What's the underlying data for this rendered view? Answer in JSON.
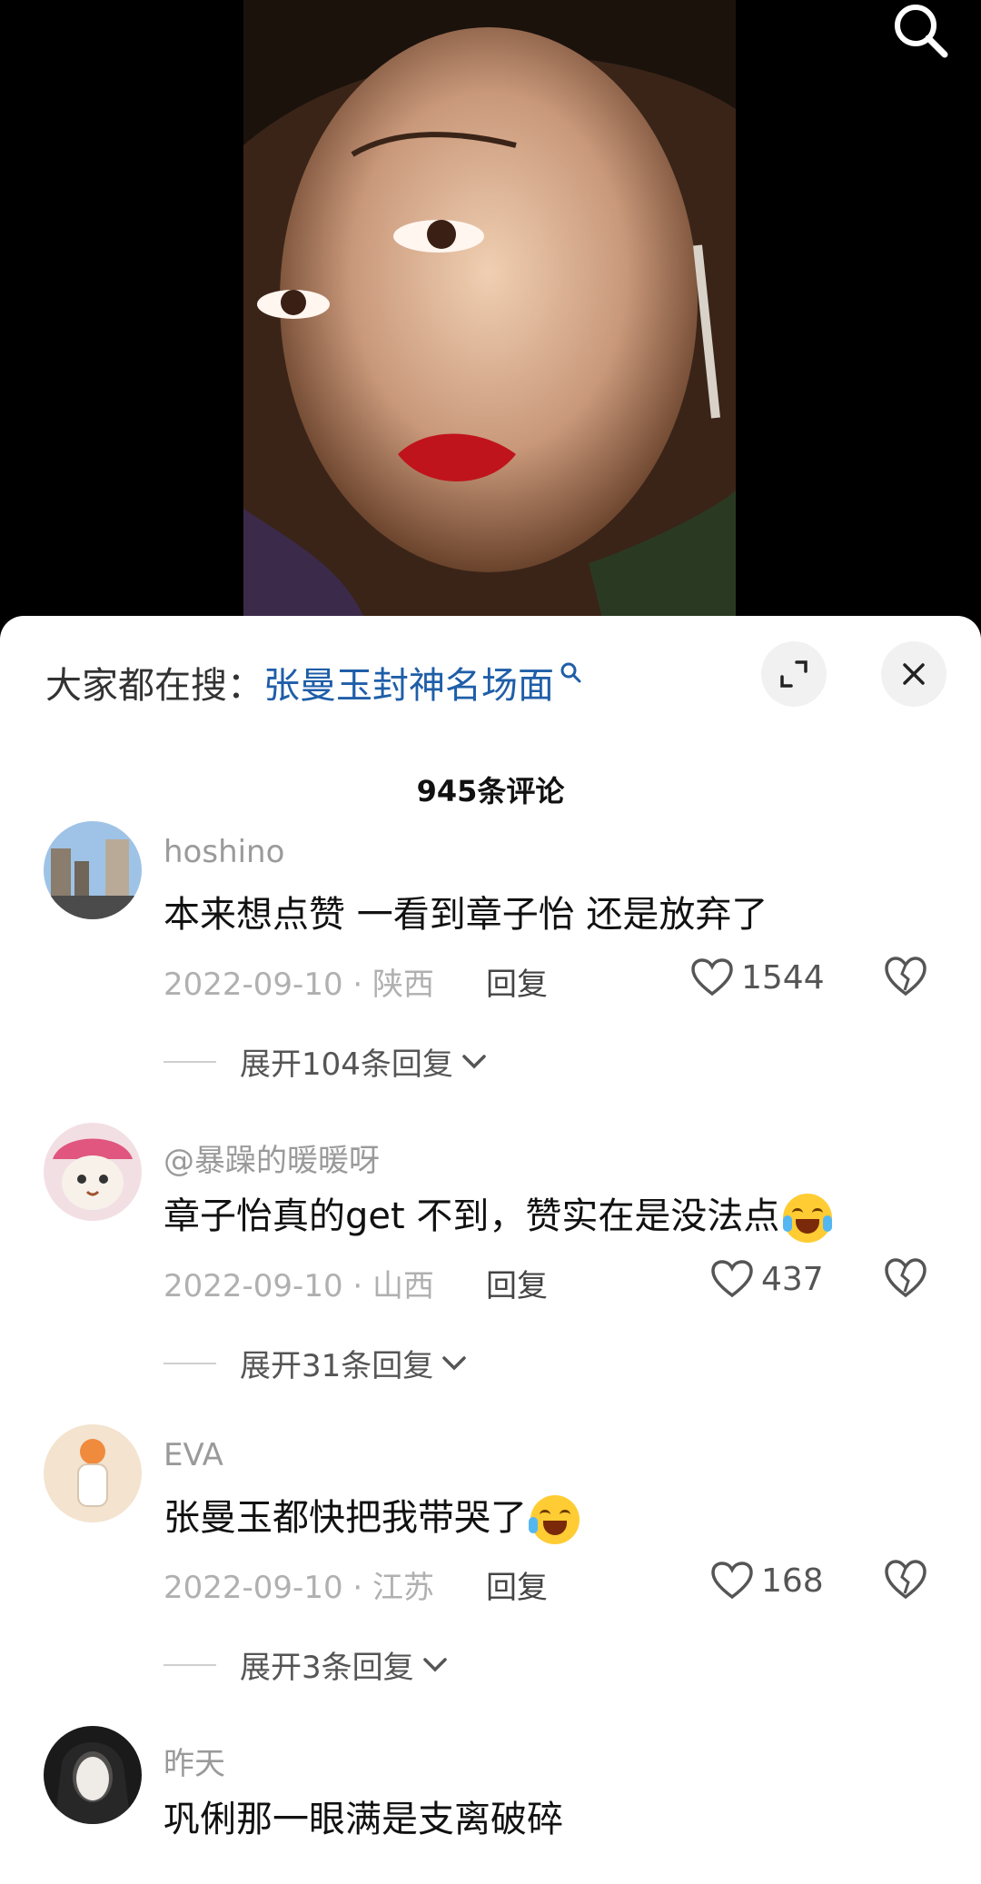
{
  "search_bar": {
    "prefix": "大家都在搜：",
    "term": "张曼玉封神名场面"
  },
  "comment_count_label": "945条评论",
  "comments": [
    {
      "user": "hoshino",
      "text": "本来想点赞 一看到章子怡 还是放弃了",
      "emoji": "",
      "meta": "2022-09-10 · 陕西",
      "reply": "回复",
      "likes": "1544",
      "expand": "展开104条回复"
    },
    {
      "user": "@暴躁的暖暖呀",
      "text": "章子怡真的get 不到，赞实在是没法点",
      "emoji": "crying-laughing-emoji",
      "meta": "2022-09-10 · 山西",
      "reply": "回复",
      "likes": "437",
      "expand": "展开31条回复"
    },
    {
      "user": "EVA",
      "text": "张曼玉都快把我带哭了",
      "emoji": "rolling-laughing-emoji",
      "meta": "2022-09-10 · 江苏",
      "reply": "回复",
      "likes": "168",
      "expand": "展开3条回复"
    },
    {
      "user": "昨天",
      "text": "巩俐那一眼满是支离破碎"
    }
  ],
  "colors": {
    "link_blue": "#1f5ea8",
    "sheet_bg": "#ffffff",
    "meta_gray": "#b0b0b0"
  }
}
